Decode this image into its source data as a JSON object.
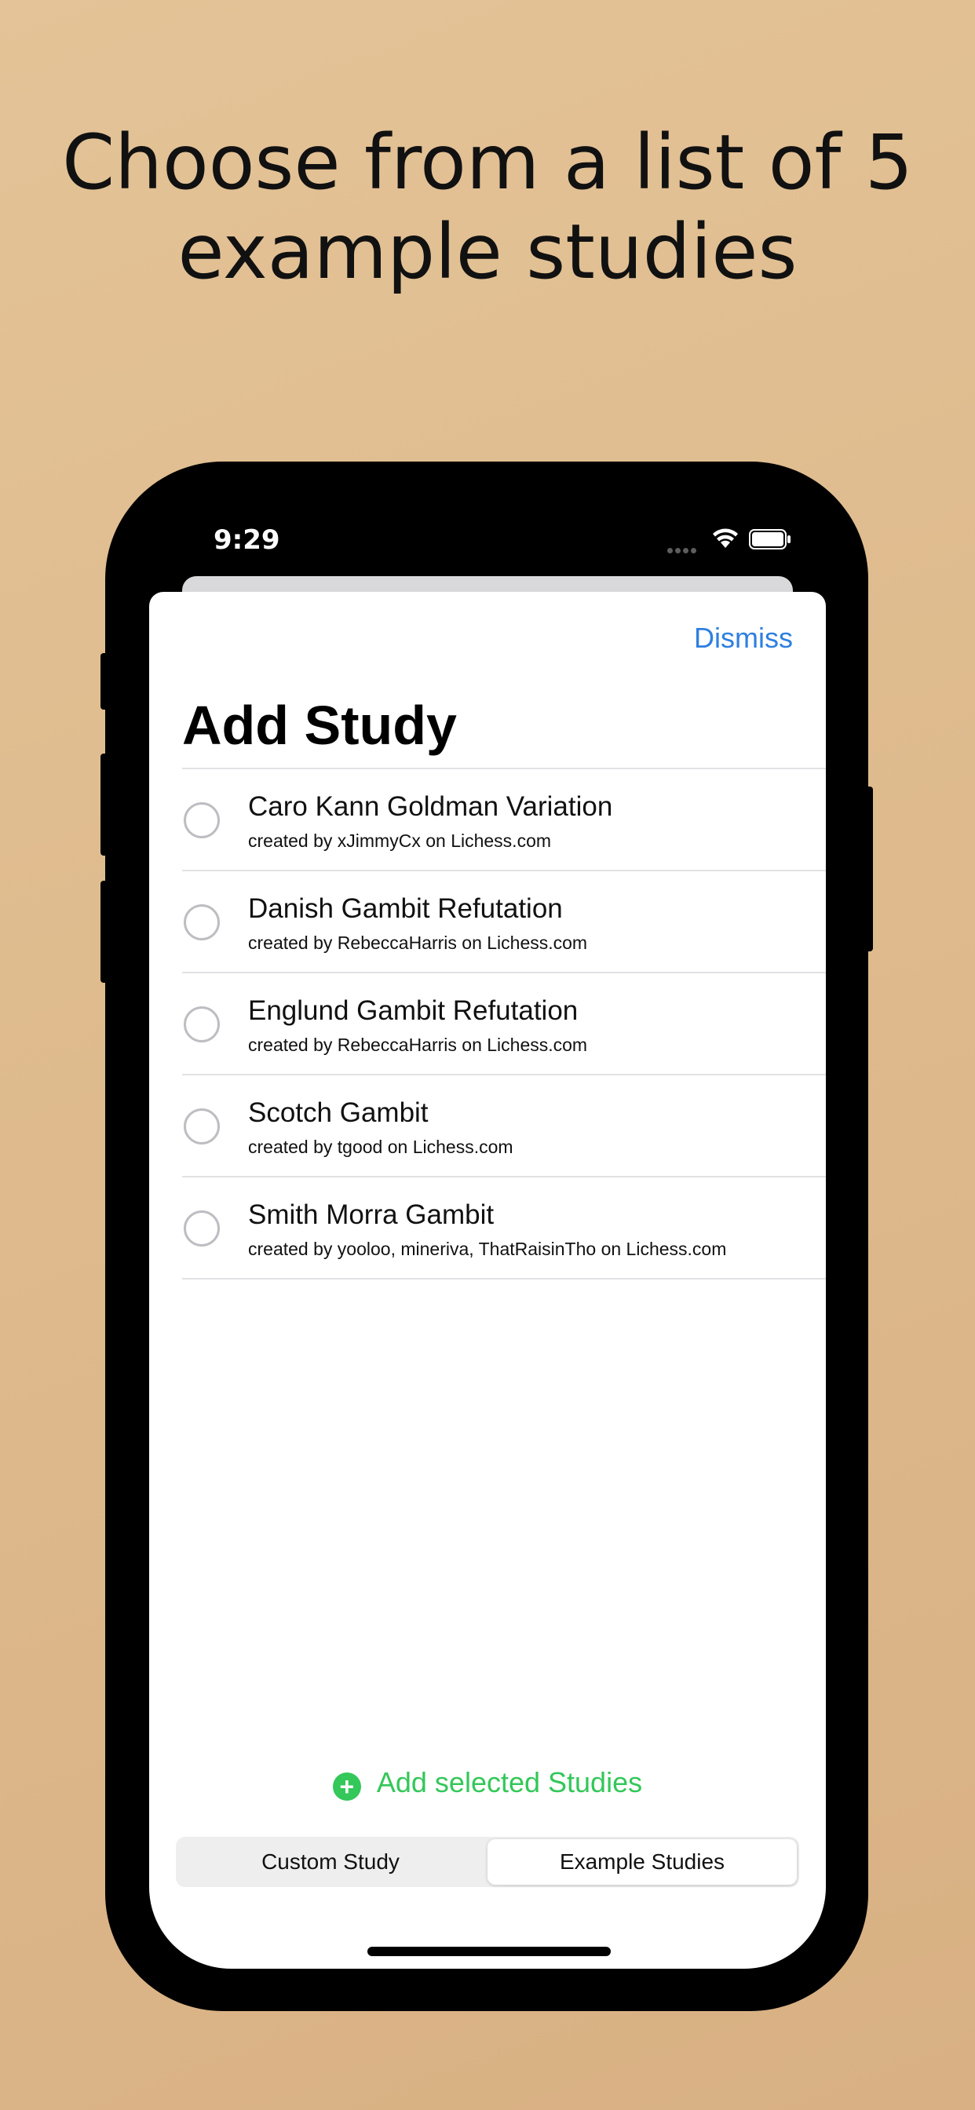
{
  "marketing": {
    "headline_line1": "Choose from a list of 5",
    "headline_line2": "example studies"
  },
  "status_bar": {
    "time": "9:29",
    "icons": [
      "signal-dots-icon",
      "wifi-icon",
      "battery-icon"
    ]
  },
  "sheet": {
    "dismiss_label": "Dismiss",
    "title": "Add Study"
  },
  "studies": [
    {
      "title": "Caro Kann Goldman Variation",
      "subtitle": "created by xJimmyCx on Lichess.com",
      "selected": false
    },
    {
      "title": "Danish Gambit Refutation",
      "subtitle": "created by RebeccaHarris on Lichess.com",
      "selected": false
    },
    {
      "title": "Englund Gambit Refutation",
      "subtitle": "created by RebeccaHarris on Lichess.com",
      "selected": false
    },
    {
      "title": "Scotch Gambit",
      "subtitle": "created by tgood on Lichess.com",
      "selected": false
    },
    {
      "title": "Smith Morra Gambit",
      "subtitle": "created by yooloo, mineriva, ThatRaisinTho on Lichess.com",
      "selected": false
    }
  ],
  "actions": {
    "add_selected_label": "Add selected Studies"
  },
  "segmented_control": {
    "options": [
      "Custom Study",
      "Example Studies"
    ],
    "selected": "Example Studies"
  },
  "colors": {
    "accent_blue": "#2f7fe0",
    "accent_green": "#34c759",
    "background": "#e0bd90"
  }
}
